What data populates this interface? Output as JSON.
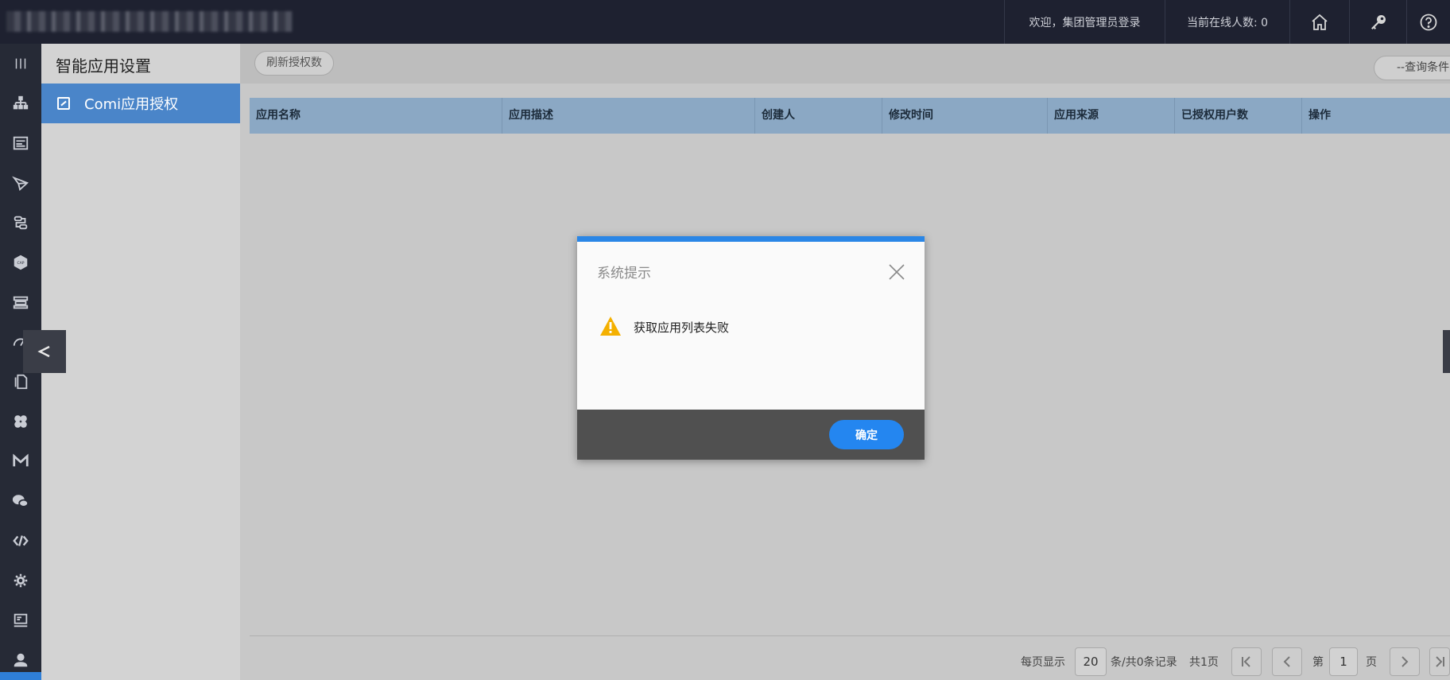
{
  "header": {
    "welcome": "欢迎，集团管理员登录",
    "online": "当前在线人数: 0",
    "icons": [
      "home-icon",
      "key-icon",
      "help-icon"
    ]
  },
  "rail": {
    "icons": [
      "menu-lines-icon",
      "org-tree-icon",
      "form-icon",
      "send-icon",
      "workflow-icon",
      "cap-icon",
      "layers-icon",
      "dashboard-icon",
      "document-icon",
      "modules-icon",
      "mail-m-icon",
      "wechat-icon",
      "code-icon",
      "gear-icon",
      "monitor-icon",
      "user-icon"
    ]
  },
  "submenu": {
    "title": "智能应用设置",
    "items": [
      {
        "label": "Comi应用授权"
      }
    ]
  },
  "toolbar": {
    "refresh_label": "刷新授权数",
    "query_label": "--查询条件"
  },
  "table": {
    "columns": [
      "应用名称",
      "应用描述",
      "创建人",
      "修改时间",
      "应用来源",
      "已授权用户数",
      "操作"
    ],
    "rows": []
  },
  "pager": {
    "per_page_label": "每页显示",
    "per_page_value": "20",
    "records_label": "条/共0条记录",
    "total_pages_label": "共1页",
    "page_prefix": "第",
    "page_value": "1",
    "page_suffix": "页"
  },
  "dialog": {
    "title": "系统提示",
    "message": "获取应用列表失败",
    "ok_label": "确定"
  },
  "colors": {
    "topbar": "#1e2130",
    "accent": "#2a86e6",
    "menu_active": "#4a85c9",
    "table_header": "#8ba8c4",
    "warning": "#f4b000"
  }
}
